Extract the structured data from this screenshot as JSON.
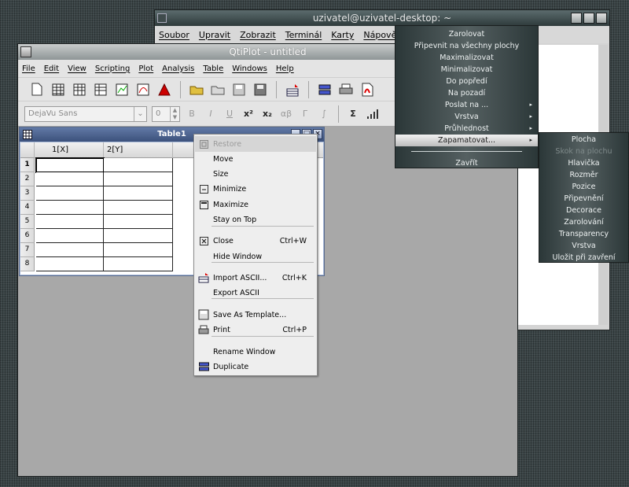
{
  "terminal": {
    "title": "uzivatel@uzivatel-desktop: ~",
    "menu": [
      "Soubor",
      "Upravit",
      "Zobrazit",
      "Terminál",
      "Karty",
      "Nápověda"
    ]
  },
  "qtiplot": {
    "title": "QtiPlot - untitled",
    "menu": [
      "File",
      "Edit",
      "View",
      "Scripting",
      "Plot",
      "Analysis",
      "Table",
      "Windows",
      "Help"
    ],
    "font_combo": "DejaVu Sans",
    "font_size": "0"
  },
  "table": {
    "title": "Table1",
    "columns": [
      "1[X]",
      "2[Y]"
    ],
    "rows": [
      "1",
      "2",
      "3",
      "4",
      "5",
      "6",
      "7",
      "8"
    ]
  },
  "context_menu": {
    "items": [
      {
        "label": "Restore",
        "shortcut": "",
        "icon": "restore-icon",
        "disabled": true
      },
      {
        "label": "Move",
        "shortcut": "",
        "icon": ""
      },
      {
        "label": "Size",
        "shortcut": "",
        "icon": ""
      },
      {
        "label": "Minimize",
        "shortcut": "",
        "icon": "minimize-icon"
      },
      {
        "label": "Maximize",
        "shortcut": "",
        "icon": "maximize-icon"
      },
      {
        "label": "Stay on Top",
        "shortcut": "",
        "icon": ""
      },
      {
        "label": "Close",
        "shortcut": "Ctrl+W",
        "icon": "close-icon"
      },
      {
        "label": "Hide Window",
        "shortcut": "",
        "icon": ""
      },
      {
        "label": "Import ASCII...",
        "shortcut": "Ctrl+K",
        "icon": "import-ascii-icon"
      },
      {
        "label": "Export ASCII",
        "shortcut": "",
        "icon": ""
      },
      {
        "label": "Save As Template...",
        "shortcut": "",
        "icon": "save-template-icon"
      },
      {
        "label": "Print",
        "shortcut": "Ctrl+P",
        "icon": "print-icon"
      },
      {
        "label": "Rename Window",
        "shortcut": "",
        "icon": ""
      },
      {
        "label": "Duplicate",
        "shortcut": "",
        "icon": "duplicate-icon"
      }
    ]
  },
  "wm_menu": {
    "items": [
      {
        "label": "Zarolovat"
      },
      {
        "label": "Připevnit na všechny plochy"
      },
      {
        "label": "Maximalizovat"
      },
      {
        "label": "Minimalizovat"
      },
      {
        "label": "Do popředí"
      },
      {
        "label": "Na pozadí"
      },
      {
        "label": "Poslat na ...",
        "submenu": true
      },
      {
        "label": "Vrstva",
        "submenu": true
      },
      {
        "label": "Průhlednost",
        "submenu": true
      },
      {
        "label": "Zapamatovat...",
        "submenu": true,
        "highlighted": true
      },
      {
        "label": "Zavřít"
      }
    ],
    "submenu_arrow": "▸"
  },
  "wm_submenu": {
    "items": [
      {
        "label": "Plocha"
      },
      {
        "label": "Skok na plochu",
        "disabled": true
      },
      {
        "label": "Hlavička"
      },
      {
        "label": "Rozměr"
      },
      {
        "label": "Pozice"
      },
      {
        "label": "Připevnění"
      },
      {
        "label": "Decorace"
      },
      {
        "label": "Zarolování"
      },
      {
        "label": "Transparency"
      },
      {
        "label": "Vrstva"
      },
      {
        "label": "Uložit při zavření"
      }
    ]
  },
  "colors": {
    "desktop": "#3a4446",
    "wm_menu_bg": "#556061",
    "table_titlebar": "#4c6290"
  }
}
